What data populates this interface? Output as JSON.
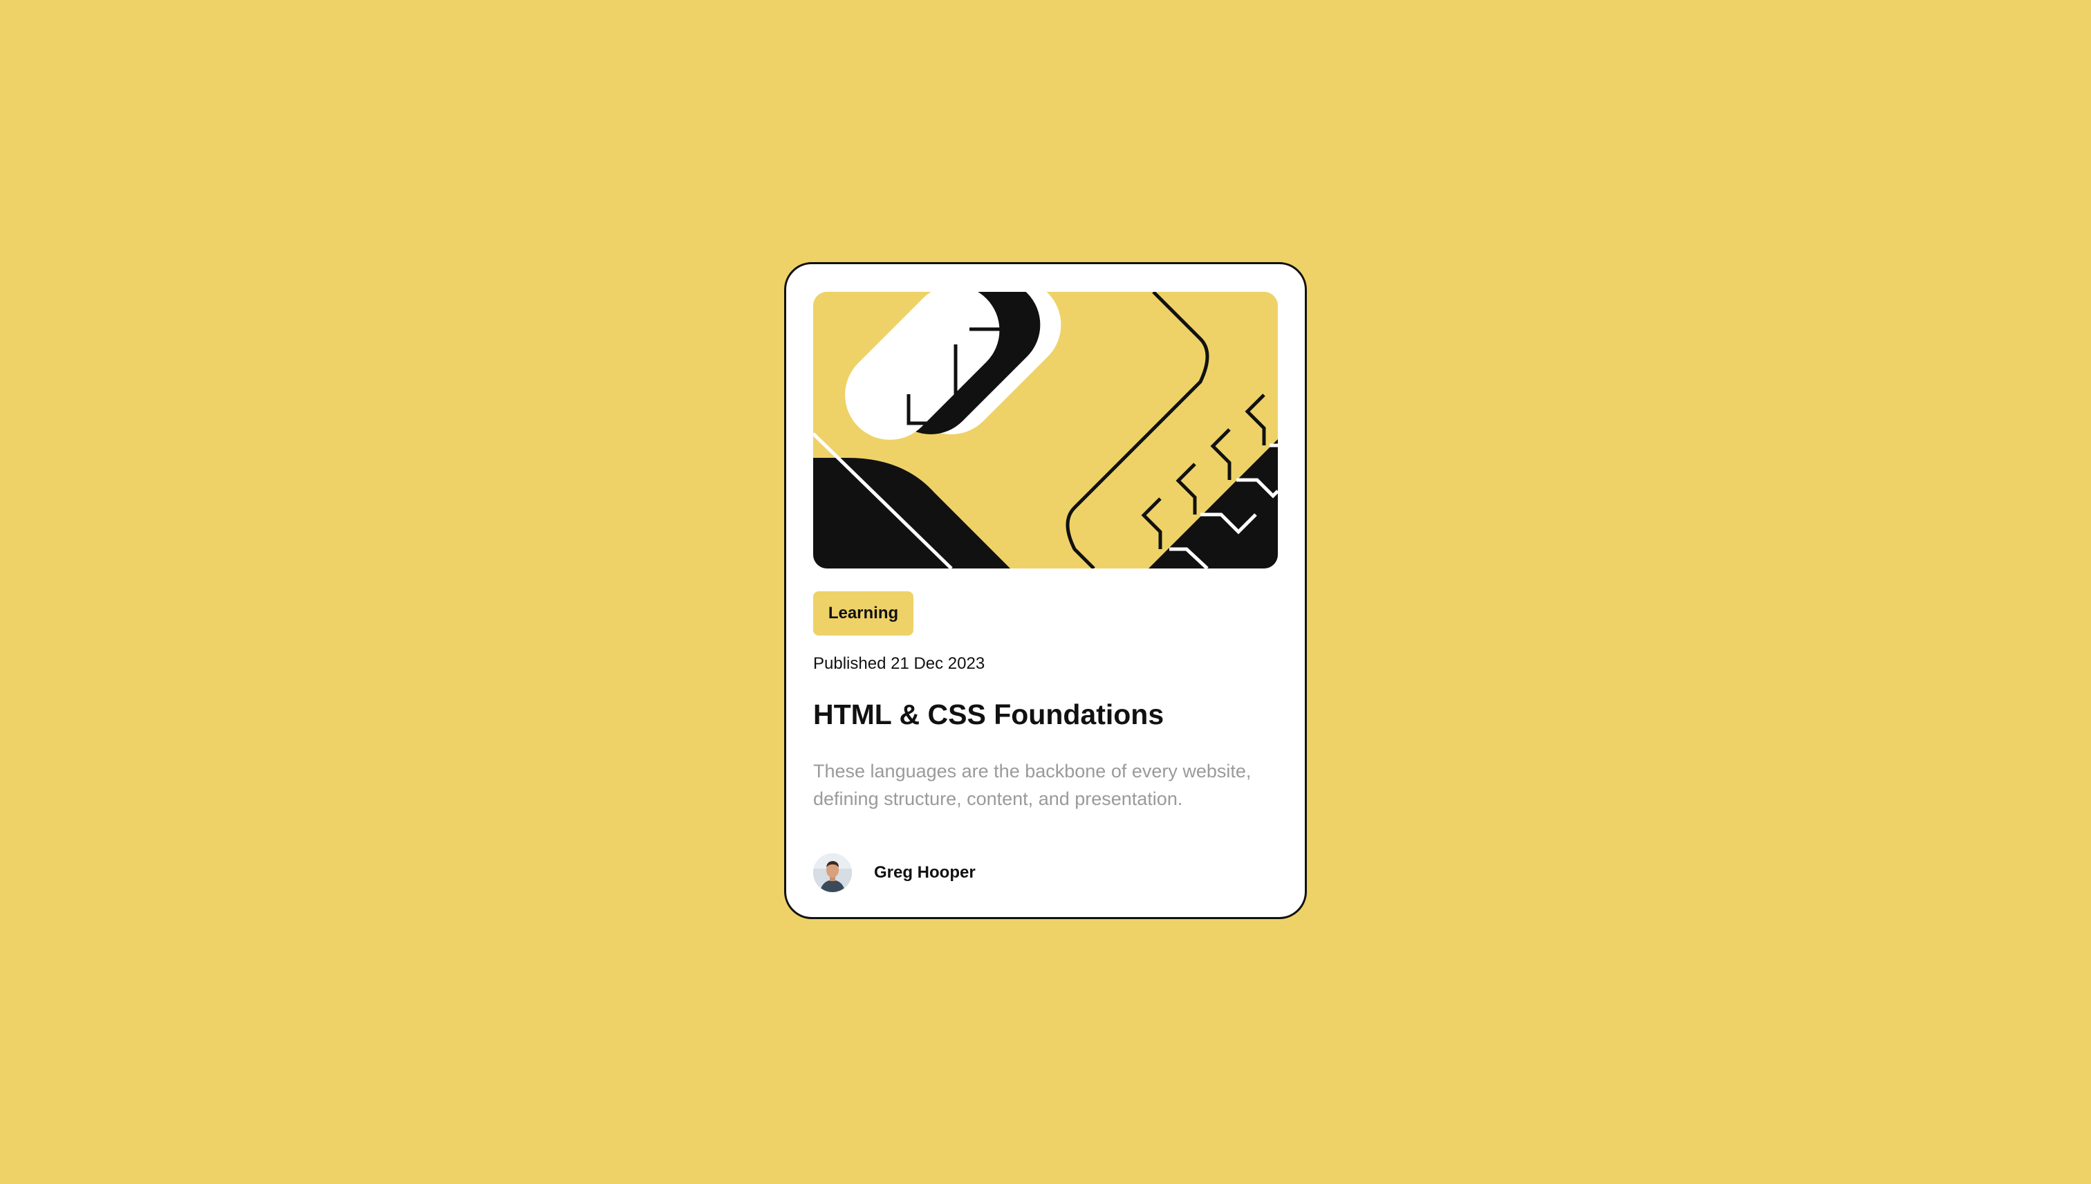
{
  "page": {
    "background_color": "#EED267"
  },
  "card": {
    "hero_image_alt": "abstract illustration",
    "tag": "Learning",
    "published": "Published 21 Dec 2023",
    "title": "HTML & CSS Foundations",
    "description": "These languages are the backbone of every website, defining structure, content, and presentation.",
    "author": {
      "name": "Greg Hooper",
      "avatar_icon": "avatar-photo"
    }
  },
  "colors": {
    "accent_yellow": "#EED267",
    "ink": "#111111",
    "muted_text": "#9a9a9a",
    "card_bg": "#ffffff"
  }
}
